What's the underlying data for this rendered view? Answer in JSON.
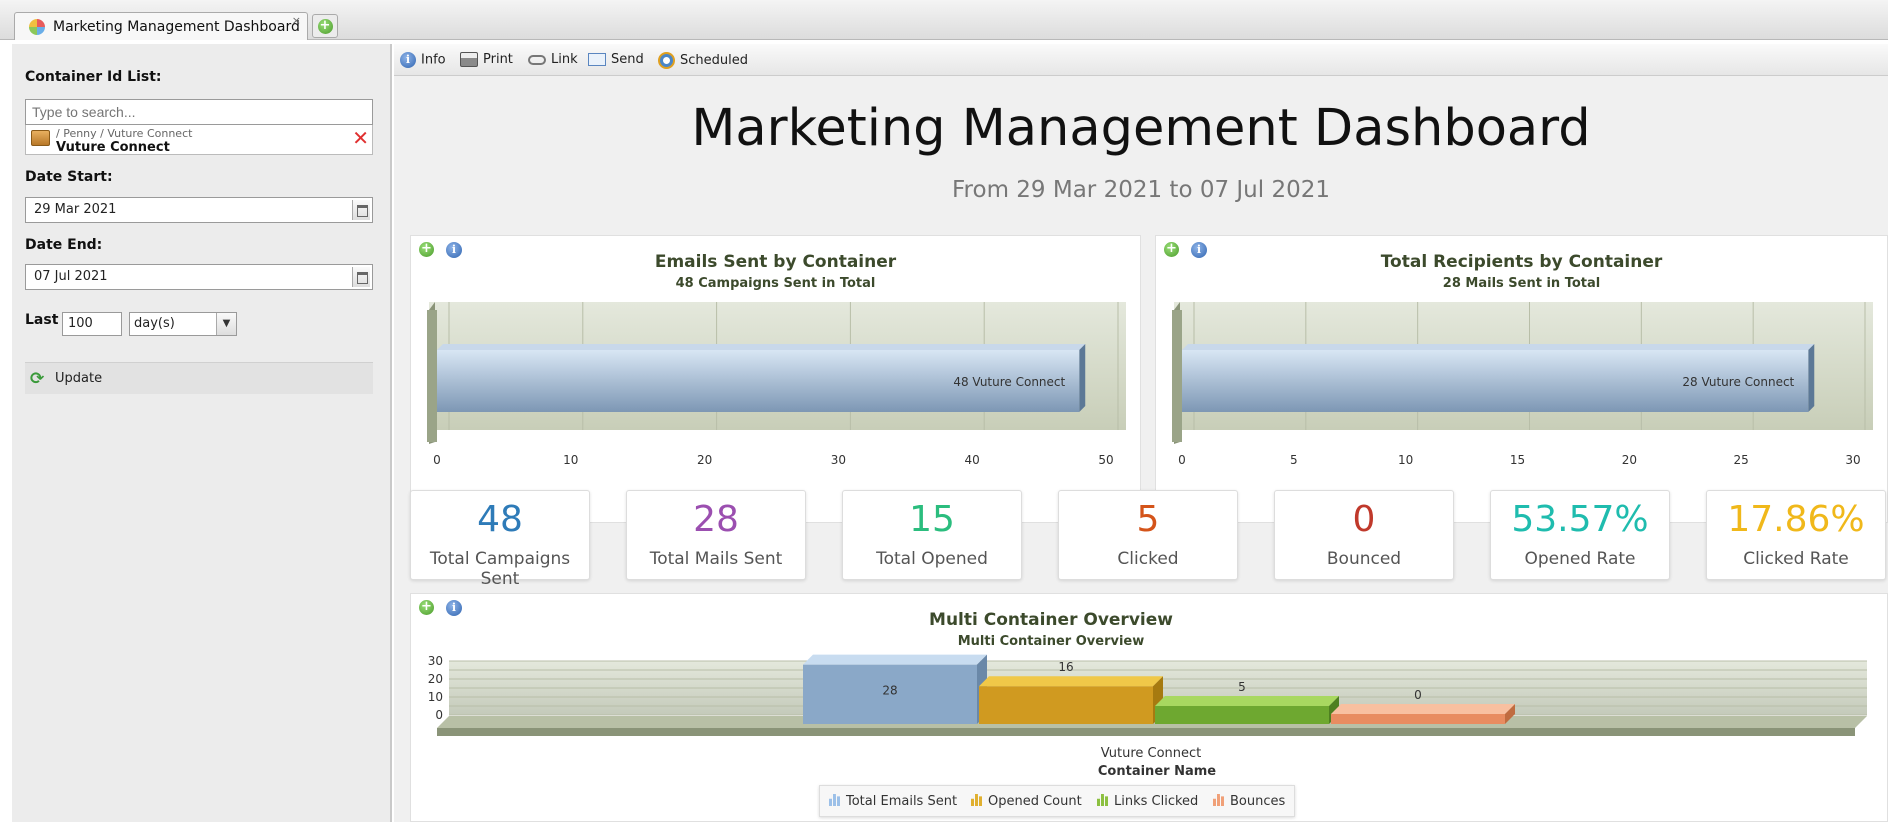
{
  "tab": {
    "title": "Marketing Management Dashboard",
    "close": "×"
  },
  "left": {
    "container_label": "Container Id List:",
    "search_placeholder": "Type to search...",
    "selected_path": "/ Penny / Vuture Connect",
    "selected_name": "Vuture Connect",
    "date_start_label": "Date Start:",
    "date_start": "29 Mar 2021",
    "date_end_label": "Date End:",
    "date_end": "07 Jul 2021",
    "last_label": "Last",
    "last_value": "100",
    "last_unit": "day(s)",
    "update_label": "Update"
  },
  "toolbar": {
    "info": "Info",
    "print": "Print",
    "link": "Link",
    "send": "Send",
    "scheduled": "Scheduled"
  },
  "dashboard": {
    "title": "Marketing Management Dashboard",
    "subtitle": "From 29 Mar 2021 to 07 Jul 2021"
  },
  "kpis": [
    {
      "value": "48",
      "label": "Total Campaigns Sent",
      "color": "#2e7bb8"
    },
    {
      "value": "28",
      "label": "Total Mails Sent",
      "color": "#9b4fb0"
    },
    {
      "value": "15",
      "label": "Total Opened",
      "color": "#2bbd7e"
    },
    {
      "value": "5",
      "label": "Clicked",
      "color": "#d4541a"
    },
    {
      "value": "0",
      "label": "Bounced",
      "color": "#c0392b"
    },
    {
      "value": "53.57%",
      "label": "Opened Rate",
      "color": "#1fbcae"
    },
    {
      "value": "17.86%",
      "label": "Clicked Rate",
      "color": "#f0b81a"
    }
  ],
  "chart_data": [
    {
      "type": "bar",
      "orientation": "horizontal",
      "title": "Emails Sent by Container",
      "subtitle": "48 Campaigns Sent in Total",
      "categories": [
        "Vuture Connect"
      ],
      "values": [
        48
      ],
      "data_labels": [
        "48 Vuture Connect"
      ],
      "xlim": [
        0,
        50
      ],
      "xticks": [
        "0",
        "10",
        "20",
        "30",
        "40",
        "50"
      ],
      "grid": true
    },
    {
      "type": "bar",
      "orientation": "horizontal",
      "title": "Total Recipients by Container",
      "subtitle": "28 Mails Sent in Total",
      "categories": [
        "Vuture Connect"
      ],
      "values": [
        28
      ],
      "data_labels": [
        "28 Vuture Connect"
      ],
      "xlim": [
        0,
        30
      ],
      "xticks": [
        "0",
        "5",
        "10",
        "15",
        "20",
        "25",
        "30"
      ],
      "grid": true
    },
    {
      "type": "bar",
      "title": "Multi Container Overview",
      "subtitle": "Multi Container Overview",
      "categories": [
        "Vuture Connect"
      ],
      "xlabel": "Container Name",
      "ylim": [
        0,
        30
      ],
      "yticks": [
        "0",
        "10",
        "20",
        "30"
      ],
      "series": [
        {
          "name": "Total Emails Sent",
          "values": [
            28
          ],
          "color": "#9cb8d6"
        },
        {
          "name": "Opened Count",
          "values": [
            16
          ],
          "color": "#e0b030"
        },
        {
          "name": "Links Clicked",
          "values": [
            5
          ],
          "color": "#8cc040"
        },
        {
          "name": "Bounces",
          "values": [
            0
          ],
          "color": "#f0a078"
        }
      ],
      "legend": "bottom"
    }
  ]
}
